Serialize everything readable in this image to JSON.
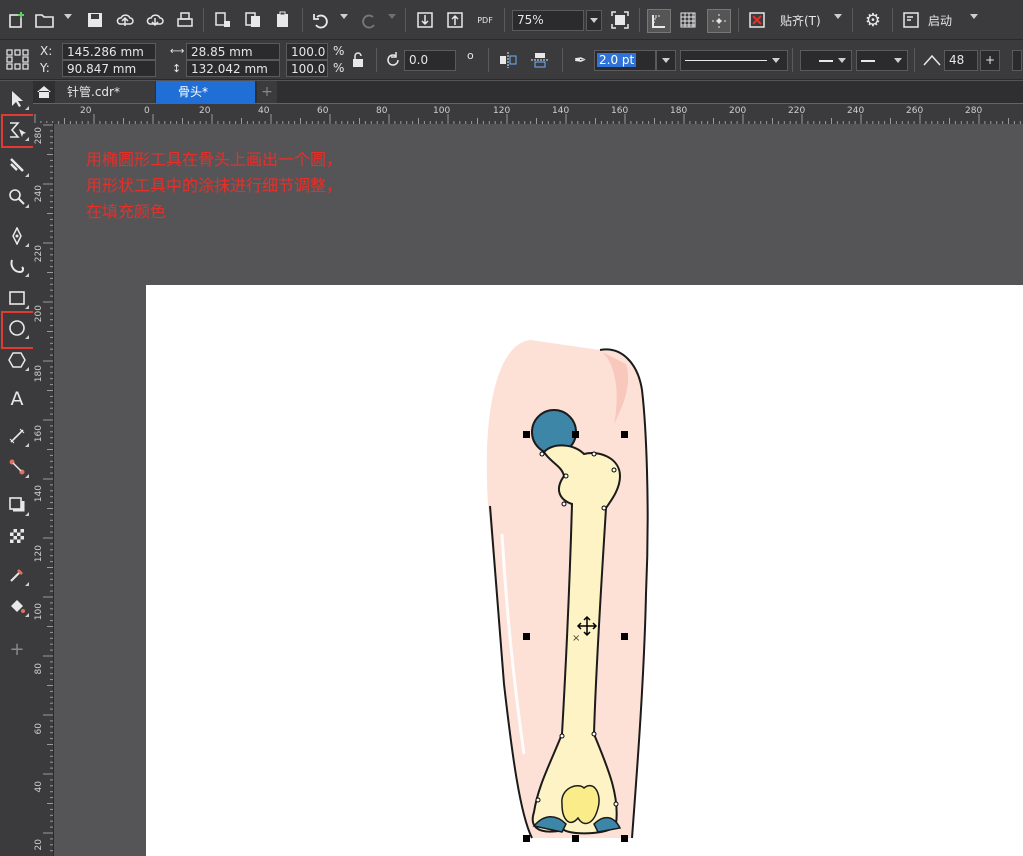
{
  "toolbar": {
    "zoom": "75%",
    "snap_label": "贴齐(T)",
    "launch_label": "启动",
    "pdf_label": "PDF"
  },
  "props": {
    "x_label": "X:",
    "y_label": "Y:",
    "x_value": "145.286 mm",
    "y_value": "90.847 mm",
    "width": "28.85 mm",
    "height": "132.042 mm",
    "scale_x": "100.0",
    "scale_y": "100.0",
    "percent": "%",
    "rotation": "0.0",
    "degree": "o",
    "outline_width": "2.0 pt",
    "miter": "48"
  },
  "tabs": [
    {
      "label": "针管.cdr*"
    },
    {
      "label": "骨头*"
    }
  ],
  "ruler": {
    "h_labels": [
      "20",
      "0",
      "20",
      "40",
      "60",
      "80",
      "100",
      "120",
      "140",
      "160",
      "180",
      "200",
      "220",
      "240",
      "260",
      "280"
    ],
    "v_labels": [
      "280",
      "240",
      "220",
      "200",
      "180",
      "160",
      "140",
      "120",
      "100",
      "80",
      "60",
      "40",
      "20"
    ]
  },
  "annotation": {
    "line1": "用椭圆形工具在骨头上画出一个圆，",
    "line2": "用形状工具中的涂抹进行细节调整，",
    "line3": "在填充颜色"
  },
  "colors": {
    "skin": "#fde0d6",
    "bone": "#fdf3c4",
    "joint_blue": "#3e86a8",
    "highlight": "#e5302a",
    "accent_blue": "#1f6fd6"
  }
}
